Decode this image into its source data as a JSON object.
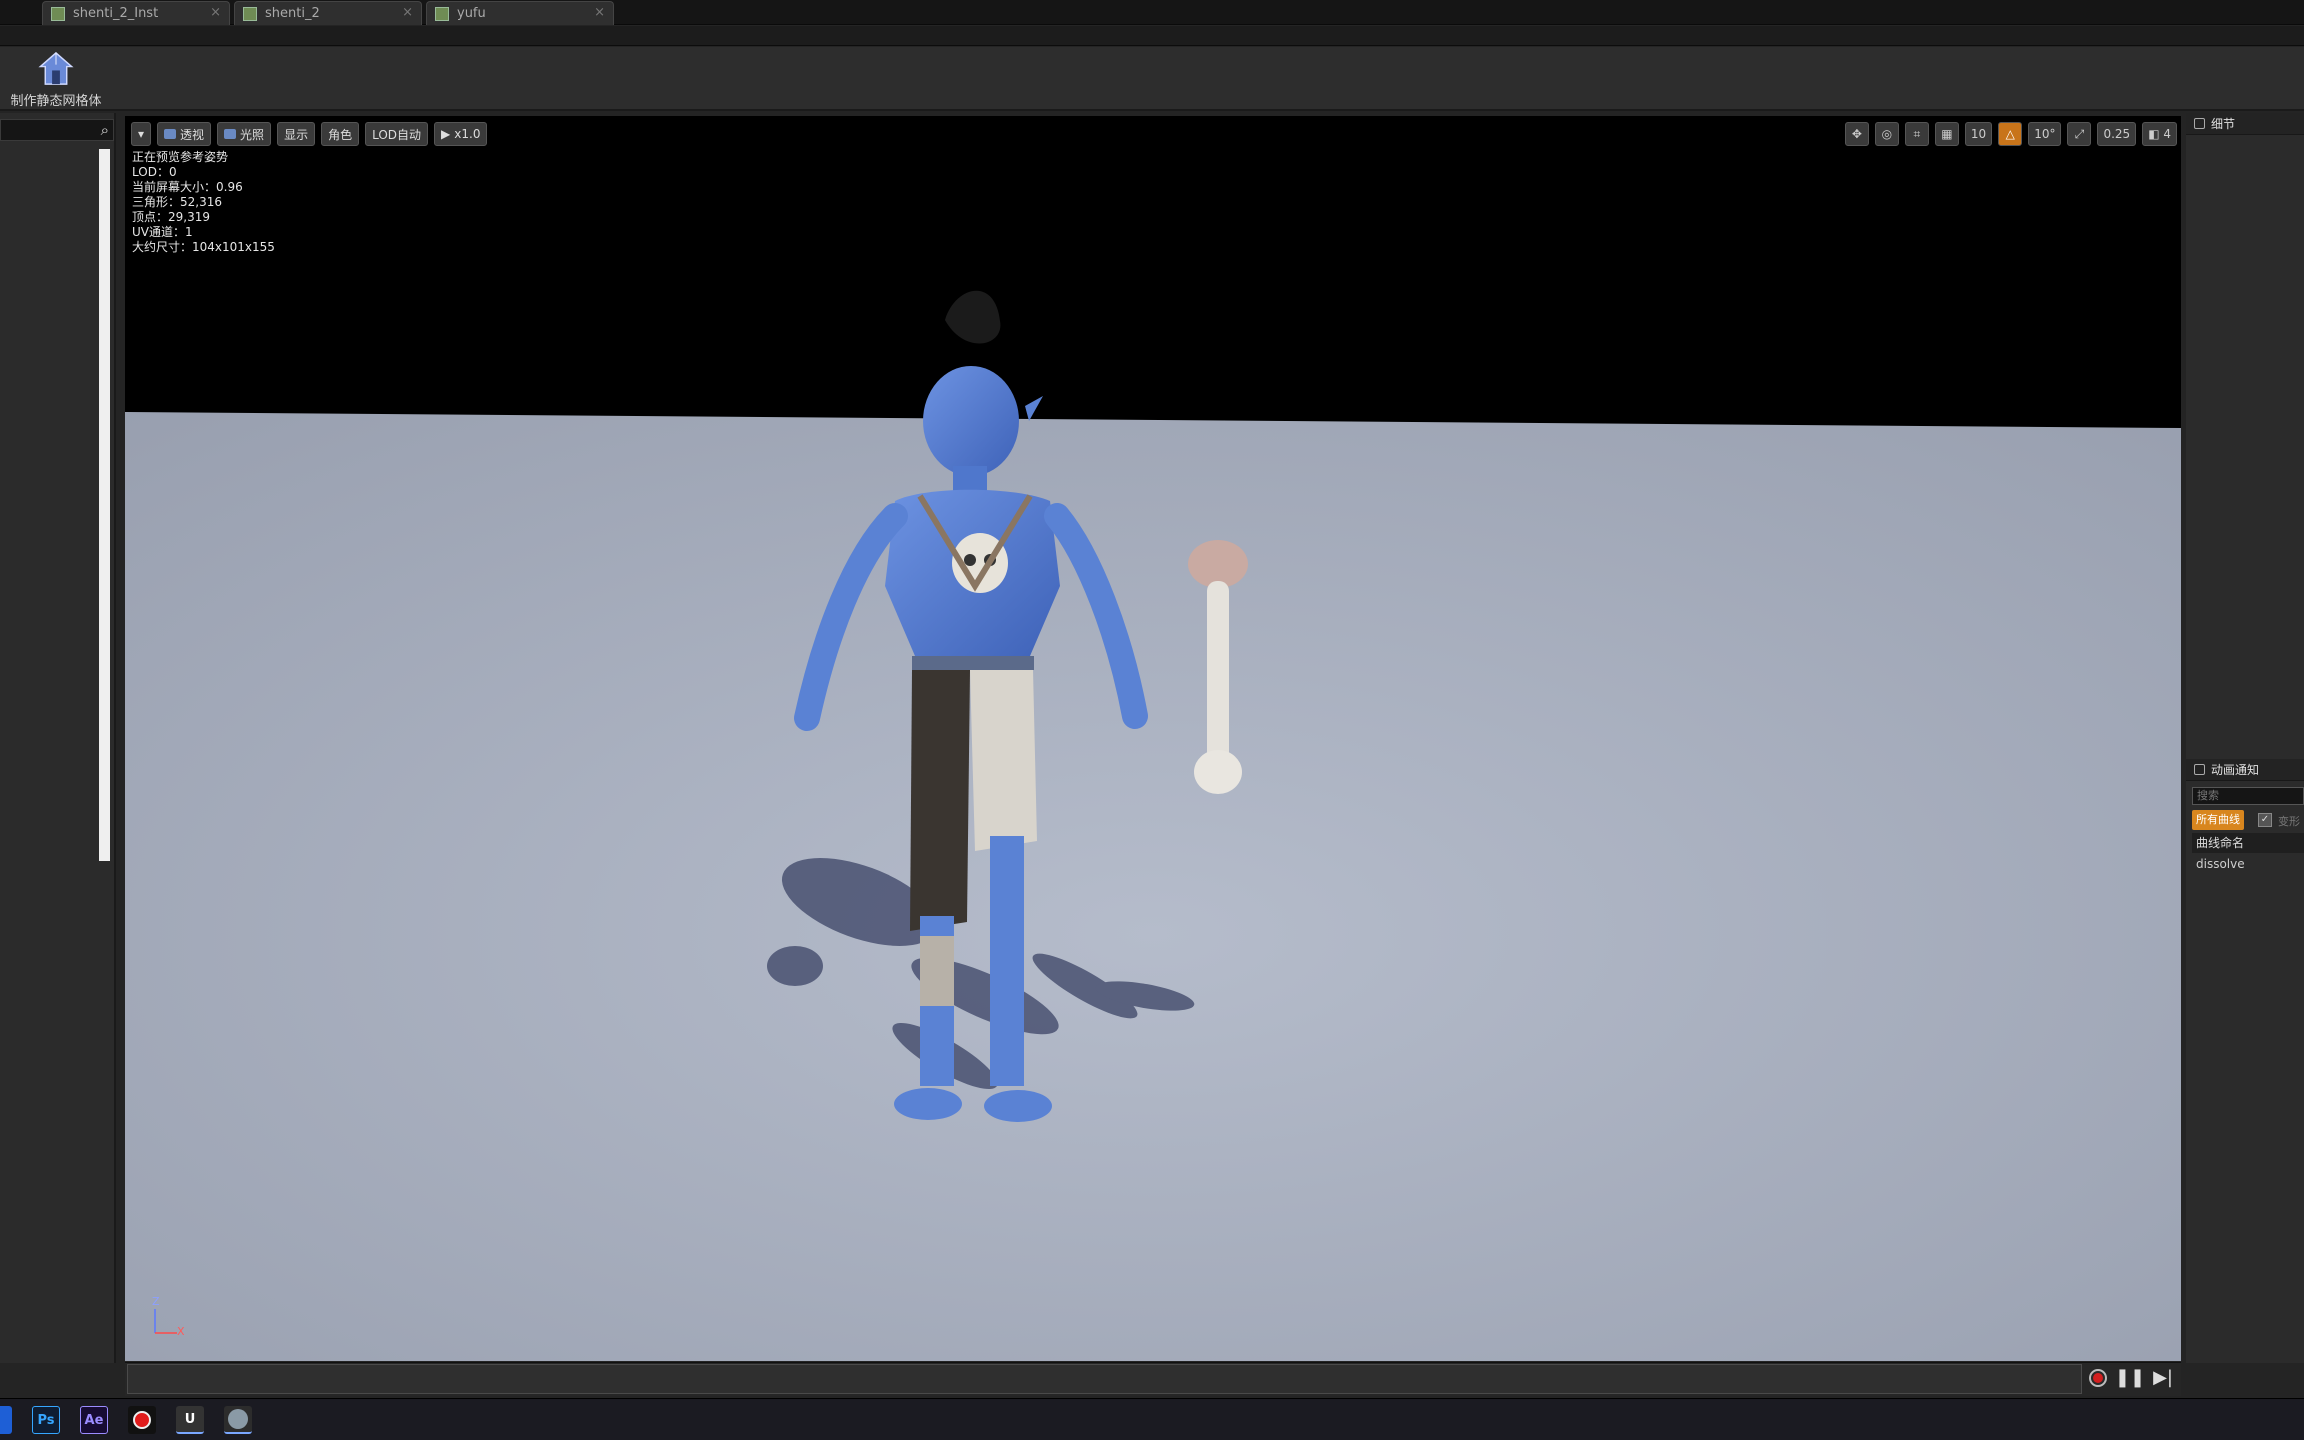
{
  "tabs": [
    {
      "label": "shenti_2_Inst"
    },
    {
      "label": "shenti_2"
    },
    {
      "label": "yufu"
    }
  ],
  "toolbar": {
    "make_static_mesh_label": "制作静态网格体"
  },
  "viewport": {
    "buttons": {
      "dropdown": "▾",
      "perspective": "透视",
      "lit": "光照",
      "show": "显示",
      "character": "角色",
      "lod": "LOD自动",
      "speed": "x1.0"
    },
    "stats": [
      "正在预览参考姿势",
      "LOD：0",
      "当前屏幕大小：0.96",
      "三角形：52,316",
      "顶点：29,319",
      "UV通道：1",
      "大约尺寸：104x101x155"
    ],
    "right_toolbar": {
      "grid_snap": "10",
      "rotation_snap": "10°",
      "scale_snap": "0.25",
      "camera_speed": "4"
    },
    "axis": {
      "z": "Z",
      "x": "X"
    }
  },
  "details_panel": {
    "title": "细节"
  },
  "anim_notify_panel": {
    "title": "动画通知",
    "search_placeholder": "搜索",
    "all_curves": "所有曲线",
    "morph_label": "变形",
    "column_header": "曲线命名",
    "curves": [
      "dissolve"
    ]
  },
  "taskbar": {
    "ps": "Ps",
    "ae": "Ae"
  },
  "colors": {
    "accent_orange": "#d8861e",
    "record_red": "#d21e1e",
    "floor": "#a9b0bf",
    "skin_blue": "#5a82d4"
  }
}
